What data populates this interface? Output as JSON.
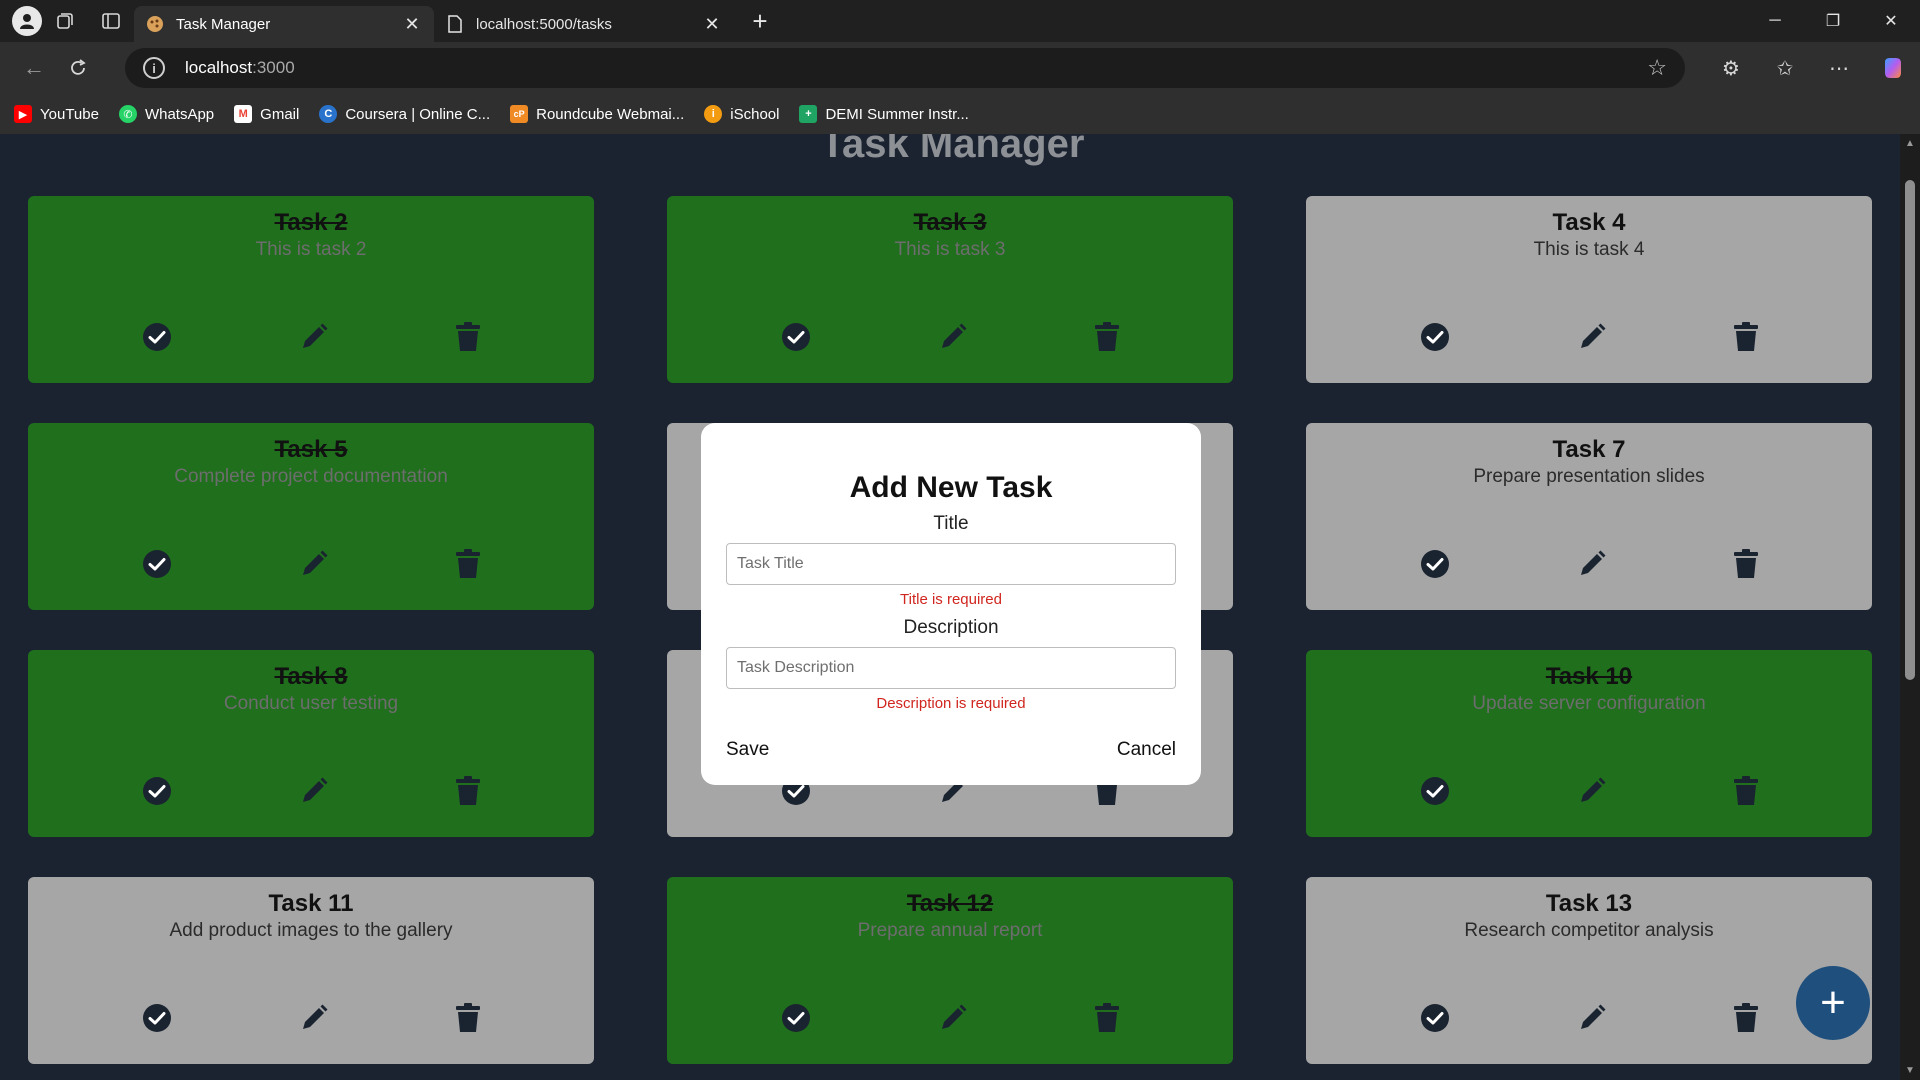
{
  "browser": {
    "tabs": [
      {
        "title": "Task Manager",
        "active": true
      },
      {
        "title": "localhost:5000/tasks",
        "active": false
      }
    ],
    "address": {
      "host": "localhost",
      "port": ":3000"
    },
    "bookmarks": [
      {
        "label": "YouTube",
        "color": "#ff0000",
        "glyph": "▶"
      },
      {
        "label": "WhatsApp",
        "color": "#25d366",
        "glyph": "✆"
      },
      {
        "label": "Gmail",
        "color": "#ea4335",
        "glyph": "M"
      },
      {
        "label": "Coursera | Online C...",
        "color": "#2a73cc",
        "glyph": "C"
      },
      {
        "label": "Roundcube Webmai...",
        "color": "#f08a24",
        "glyph": "cP"
      },
      {
        "label": "iSchool",
        "color": "#f39c12",
        "glyph": "i"
      },
      {
        "label": "DEMI Summer Instr...",
        "color": "#1fa463",
        "glyph": "+"
      }
    ]
  },
  "app": {
    "title": "Task Manager",
    "tasks": [
      {
        "title": "Task 2",
        "description": "This is task 2",
        "completed": true
      },
      {
        "title": "Task 3",
        "description": "This is task 3",
        "completed": true
      },
      {
        "title": "Task 4",
        "description": "This is task 4",
        "completed": false
      },
      {
        "title": "Task 5",
        "description": "Complete project documentation",
        "completed": true
      },
      {
        "title": "",
        "description": "",
        "completed": false
      },
      {
        "title": "Task 7",
        "description": "Prepare presentation slides",
        "completed": false
      },
      {
        "title": "Task 8",
        "description": "Conduct user testing",
        "completed": true
      },
      {
        "title": "",
        "description": "",
        "completed": false
      },
      {
        "title": "Task 10",
        "description": "Update server configuration",
        "completed": true
      },
      {
        "title": "Task 11",
        "description": "Add product images to the gallery",
        "completed": false
      },
      {
        "title": "Task 12",
        "description": "Prepare annual report",
        "completed": true
      },
      {
        "title": "Task 13",
        "description": "Research competitor analysis",
        "completed": false
      }
    ],
    "fab_label": "+"
  },
  "modal": {
    "heading": "Add New Task",
    "title_label": "Title",
    "title_placeholder": "Task Title",
    "title_value": "",
    "title_error": "Title is required",
    "description_label": "Description",
    "description_placeholder": "Task Description",
    "description_value": "",
    "description_error": "Description is required",
    "save_label": "Save",
    "cancel_label": "Cancel"
  },
  "colors": {
    "completed_card": "#1f6f1d",
    "pending_card": "#a6a6a6",
    "page_background": "#1b2230",
    "fab": "#1f4f7d",
    "error": "#d0261f"
  }
}
